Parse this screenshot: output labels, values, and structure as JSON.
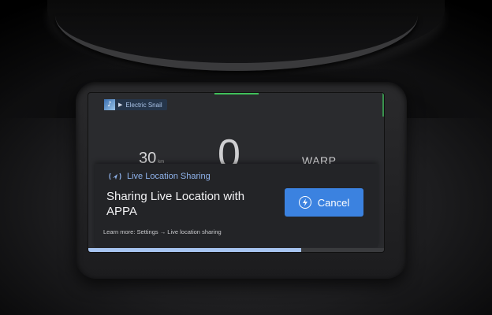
{
  "media": {
    "title": "Electric Snail",
    "play_glyph": "▶",
    "art_icon": "album-art-icon"
  },
  "dashboard": {
    "left_speed": "30",
    "left_unit": "km",
    "main_speed": "0",
    "mode": "WARP"
  },
  "notification": {
    "header_label": "Live Location Sharing",
    "header_icon": "location-sharing-icon",
    "title": "Sharing Live Location with APPA",
    "cancel_label": "Cancel",
    "cancel_icon": "lightning-circle-icon",
    "learn_more": "Learn more: Settings → Live location sharing",
    "progress": 0.72
  },
  "colors": {
    "accent": "#3b82e0",
    "progress": "#a7c4f0",
    "indicator": "#3fbf5a",
    "header_text": "#8fb3ec"
  }
}
